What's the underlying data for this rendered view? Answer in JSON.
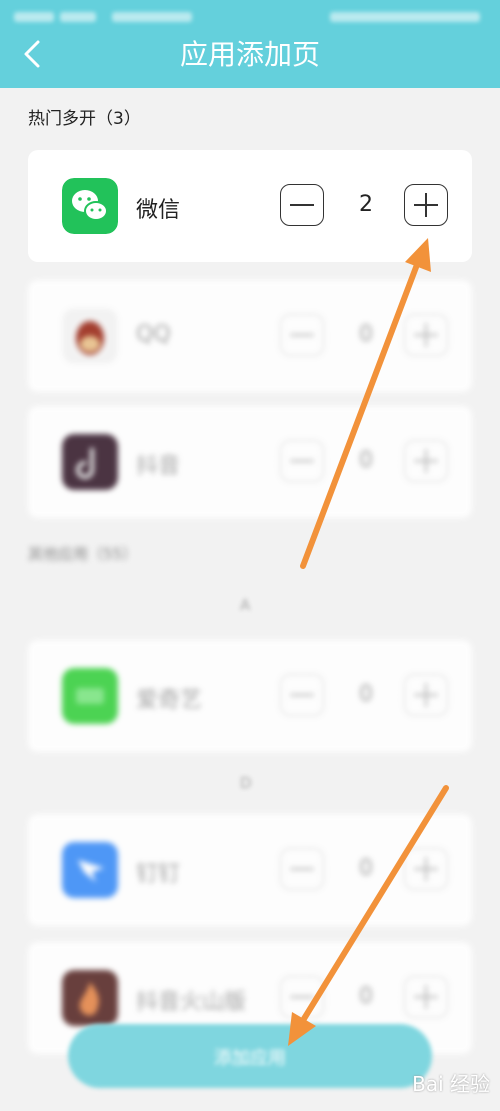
{
  "header": {
    "title": "应用添加页",
    "back_icon": "chevron-left-icon",
    "background": "#64d0dc"
  },
  "hot_section": {
    "title": "热门多开（3）"
  },
  "hot_apps": [
    {
      "name": "微信",
      "count": "2",
      "icon": "wechat-icon",
      "color": "#22c25a"
    },
    {
      "name": "QQ",
      "count": "0",
      "icon": "qq-icon",
      "color": "#9b2b1a"
    },
    {
      "name": "抖音",
      "count": "0",
      "icon": "douyin-icon",
      "color": "#3a2030"
    }
  ],
  "other_section": {
    "title": "其他应用（55）"
  },
  "groups": [
    {
      "letter": "A",
      "apps": [
        {
          "name": "爱奇艺",
          "count": "0",
          "icon": "iqiyi-icon",
          "color": "#3bd042"
        }
      ]
    },
    {
      "letter": "D",
      "apps": [
        {
          "name": "钉钉",
          "count": "0",
          "icon": "dingtalk-icon",
          "color": "#3d8ef7"
        },
        {
          "name": "抖音火山版",
          "count": "0",
          "icon": "huoshan-icon",
          "color": "#5a2c2a"
        }
      ]
    }
  ],
  "add_button": {
    "label": "添加应用",
    "color": "#7fd6df"
  },
  "annotation": {
    "arrow_color": "#f2923a"
  },
  "watermark": {
    "text": "Bai 经验"
  }
}
